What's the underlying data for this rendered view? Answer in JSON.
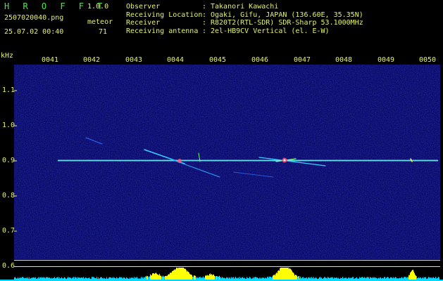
{
  "header": {
    "app_name": "H R O F F T",
    "version": "1.0.0",
    "filename": "2507020040.png",
    "timestamp": "25.07.02 00:40",
    "meteor_label": "meteor",
    "meteor_count": "71"
  },
  "info": {
    "rows": [
      {
        "label": "Observer",
        "value": "Takanori Kawachi"
      },
      {
        "label": "Receiving Location",
        "value": "Ogaki, Gifu, JAPAN (136.60E, 35.35N)"
      },
      {
        "label": "Receiver",
        "value": "R820T2(RTL-SDR) SDR-Sharp 53.1000MHz"
      },
      {
        "label": "Receiving antenna",
        "value": "2el-HB9CV Vertical (el. E-W)"
      }
    ],
    "separator": ":"
  },
  "axis": {
    "unit": "kHz",
    "y_ticks": [
      "1.1",
      "1.0",
      "0.9",
      "0.8",
      "0.7",
      "0.6"
    ],
    "x_ticks": [
      "0041",
      "0042",
      "0043",
      "0044",
      "0045",
      "0046",
      "0047",
      "0048",
      "0049",
      "0050"
    ]
  },
  "colors": {
    "background": "#000000",
    "waterfall": "#0a0a66",
    "label": "#e6f26a",
    "brand": "#4fe34f",
    "carrier": "#33ccff",
    "amplitude": "#00d8ff",
    "amplitude_peak": "#ffff00",
    "guide_line": "#d8d8d8"
  }
}
